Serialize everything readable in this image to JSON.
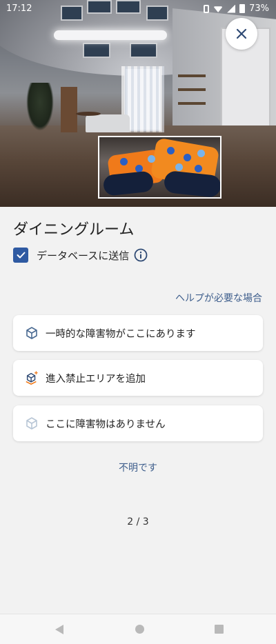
{
  "status_bar": {
    "time": "17:12",
    "battery": "73%"
  },
  "detection": {
    "room_name": "ダイニングルーム"
  },
  "send_to_database": {
    "label": "データベースに送信",
    "checked": true
  },
  "help_link": "ヘルプが必要な場合",
  "options": [
    {
      "label": "一時的な障害物がここにあります",
      "icon": "cube-icon"
    },
    {
      "label": "進入禁止エリアを追加",
      "icon": "no-go-zone-cube-icon"
    },
    {
      "label": "ここに障害物はありません",
      "icon": "cube-outline-icon"
    }
  ],
  "unknown_link": "不明です",
  "pager": "2 / 3",
  "colors": {
    "accent": "#2f5aa2",
    "link": "#3e5e8c",
    "background": "#f2f2f2",
    "orange_accent": "#f07a1a"
  }
}
